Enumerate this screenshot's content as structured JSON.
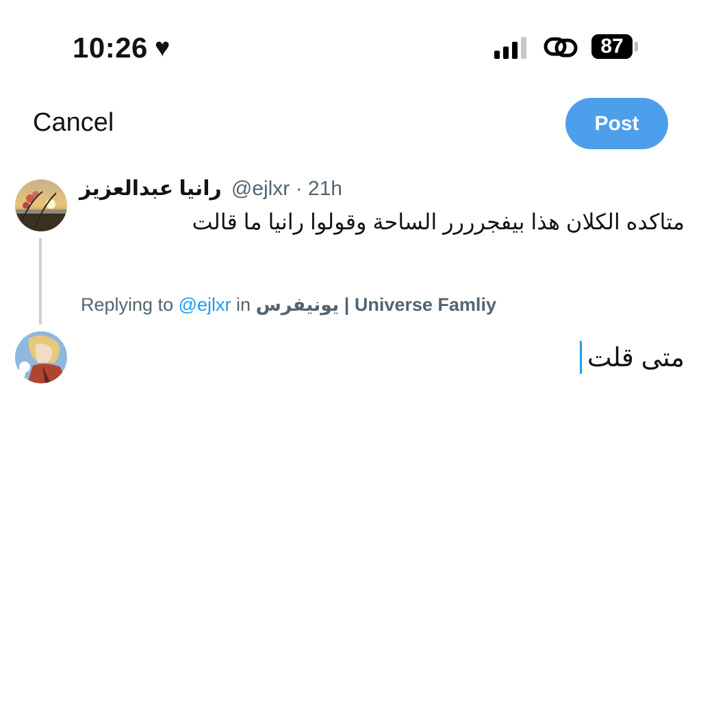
{
  "status_bar": {
    "time": "10:26",
    "battery": "87"
  },
  "header": {
    "cancel_label": "Cancel",
    "post_label": "Post"
  },
  "tweet": {
    "author_name": "رانيا عبدالعزيز",
    "author_meta": "@ejlxr · 21h",
    "text": "متاكده الكلان هذا بيفجرررر الساحة وقولوا رانيا ما قالت"
  },
  "reply_context": {
    "prefix": "Replying to",
    "handle": "@ejlxr",
    "in_word": "in",
    "community": "يونيفرس | Universe Famliy"
  },
  "compose": {
    "text": "متى قلت"
  },
  "colors": {
    "post_button": "#4d9feb",
    "link": "#1d9bf0",
    "secondary_text": "#536471"
  }
}
